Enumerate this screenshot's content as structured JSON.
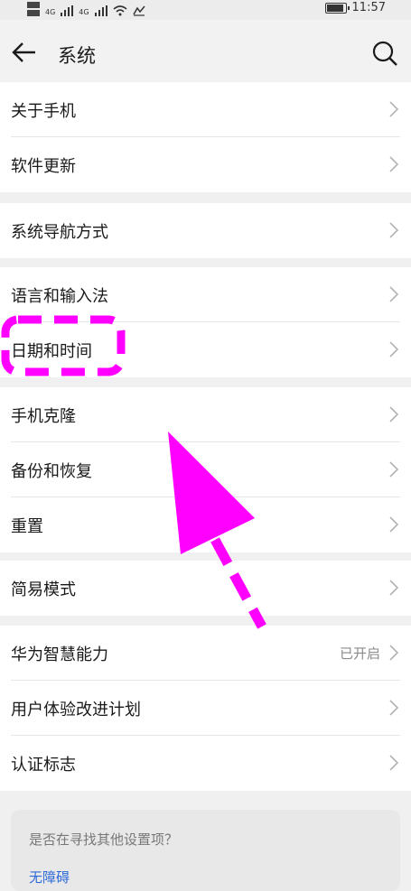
{
  "status_bar": {
    "time": "11:57",
    "net1": "4G",
    "net2": "4G"
  },
  "header": {
    "title": "系统"
  },
  "groups": [
    {
      "items": [
        {
          "label": "关于手机"
        },
        {
          "label": "软件更新"
        }
      ]
    },
    {
      "items": [
        {
          "label": "系统导航方式"
        }
      ]
    },
    {
      "items": [
        {
          "label": "语言和输入法"
        },
        {
          "label": "日期和时间"
        }
      ]
    },
    {
      "items": [
        {
          "label": "手机克隆"
        },
        {
          "label": "备份和恢复"
        },
        {
          "label": "重置"
        }
      ]
    },
    {
      "items": [
        {
          "label": "简易模式"
        }
      ]
    },
    {
      "items": [
        {
          "label": "华为智慧能力",
          "value": "已开启"
        },
        {
          "label": "用户体验改进计划"
        },
        {
          "label": "认证标志"
        }
      ]
    }
  ],
  "suggest": {
    "question": "是否在寻找其他设置项？",
    "link": "无障碍"
  },
  "colors": {
    "annotation": "#ff00ff",
    "link": "#2d6ad9",
    "background": "#f0f0f0"
  }
}
